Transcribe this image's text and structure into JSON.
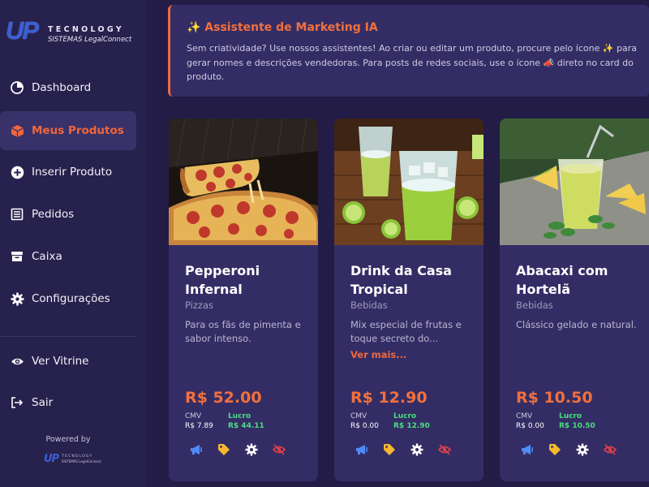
{
  "brand": {
    "mark": "UP",
    "name": "TECNOLOGY",
    "subtitle": "SISTEMAS LegalConnect"
  },
  "sidebar": {
    "items": [
      {
        "label": "Dashboard",
        "icon": "pie-chart-icon",
        "active": false
      },
      {
        "label": "Meus Produtos",
        "icon": "box-icon",
        "active": true
      },
      {
        "label": "Inserir Produto",
        "icon": "plus-circle-icon",
        "active": false
      },
      {
        "label": "Pedidos",
        "icon": "receipt-icon",
        "active": false
      },
      {
        "label": "Caixa",
        "icon": "archive-icon",
        "active": false
      },
      {
        "label": "Configurações",
        "icon": "gear-icon",
        "active": false
      }
    ],
    "secondary": [
      {
        "label": "Ver Vitrine",
        "icon": "eye-icon"
      },
      {
        "label": "Sair",
        "icon": "logout-icon"
      }
    ],
    "powered_by": "Powered by"
  },
  "banner": {
    "title": "✨ Assistente de Marketing IA",
    "text": "Sem criatividade? Use nossos assistentes! Ao criar ou editar um produto, procure pelo ícone ✨ para gerar nomes e descrições vendedoras. Para posts de redes sociais, use o ícone 📣 direto no card do produto."
  },
  "products": [
    {
      "name": "Pepperoni Infernal",
      "category": "Pizzas",
      "description": "Para os fãs de pimenta e sabor intenso.",
      "more": "",
      "price": "R$ 52.00",
      "cmv_label": "CMV",
      "cmv": "R$ 7.89",
      "lucro_label": "Lucro",
      "lucro": "R$ 44.11"
    },
    {
      "name": "Drink da Casa Tropical",
      "category": "Bebidas",
      "description": "Mix especial de frutas e toque secreto do...",
      "more": "Ver mais...",
      "price": "R$ 12.90",
      "cmv_label": "CMV",
      "cmv": "R$ 0.00",
      "lucro_label": "Lucro",
      "lucro": "R$ 12.90"
    },
    {
      "name": "Abacaxi com Hortelã",
      "category": "Bebidas",
      "description": "Clássico gelado e natural.",
      "more": "",
      "price": "R$ 10.50",
      "cmv_label": "CMV",
      "cmv": "R$ 0.00",
      "lucro_label": "Lucro",
      "lucro": "R$ 10.50"
    }
  ],
  "colors": {
    "accent": "#f0673b",
    "background": "#221c46",
    "sidebar": "#27214d",
    "card": "#342d65",
    "profit": "#4ade80"
  }
}
